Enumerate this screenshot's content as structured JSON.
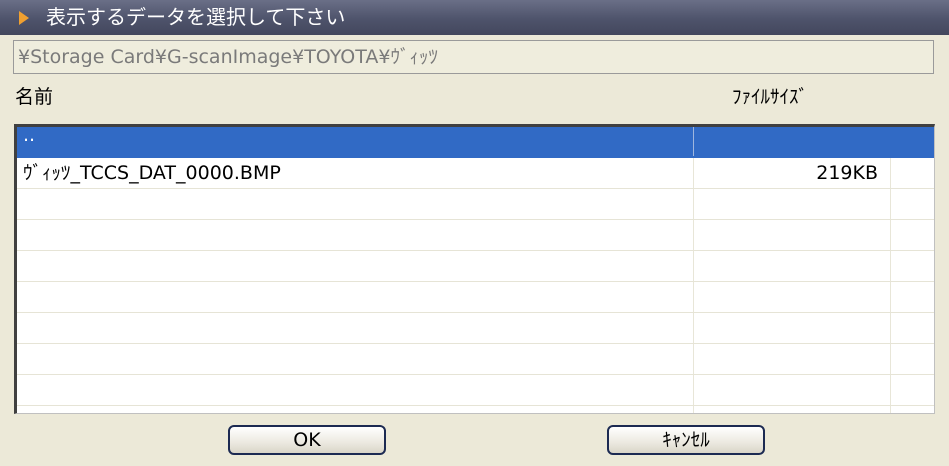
{
  "title": "表示するデータを選択して下さい",
  "path": "¥Storage Card¥G-scanImage¥TOYOTA¥ｳﾞｨｯﾂ",
  "columns": {
    "name": "名前",
    "size": "ﾌｧｲﾙｻｲｽﾞ"
  },
  "rows": [
    {
      "name": "..",
      "size": "",
      "selected": true
    },
    {
      "name": "ｳﾞｨｯﾂ_TCCS_DAT_0000.BMP",
      "size": "219KB",
      "selected": false
    }
  ],
  "buttons": {
    "ok": "OK",
    "cancel": "ｷｬﾝｾﾙ"
  },
  "colors": {
    "selection": "#316ac5",
    "titlebar": "#4e536b",
    "accent_arrow": "#f0a030"
  }
}
